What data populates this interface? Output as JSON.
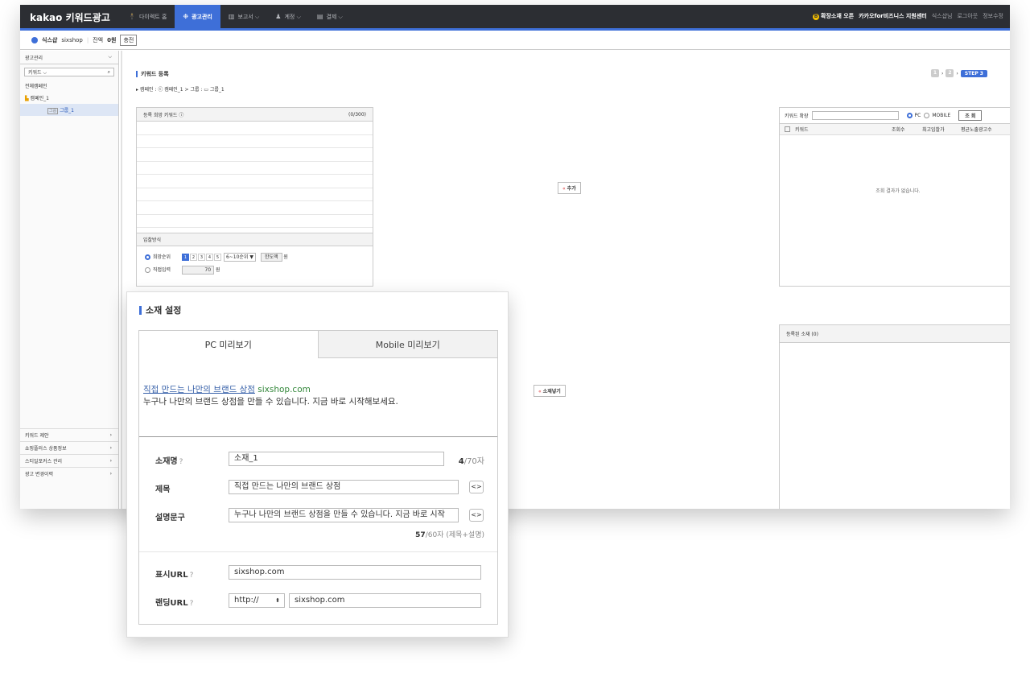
{
  "app": {
    "logo": "kakao 키워드광고"
  },
  "nav": [
    {
      "icon": "🕴",
      "label": "다이렉트 홈",
      "active": false
    },
    {
      "icon": "❉",
      "label": "광고관리",
      "active": true
    },
    {
      "icon": "▥",
      "label": "보고서 ⌵",
      "active": false
    },
    {
      "icon": "♟",
      "label": "계정 ⌵",
      "active": false
    },
    {
      "icon": "▤",
      "label": "결제 ⌵",
      "active": false
    }
  ],
  "top_right": {
    "badge": "B",
    "intro": "확장소재 오픈",
    "center": "카카오for비즈니스 지원센터",
    "user": "식스샵님",
    "logout": "로그아웃",
    "account": "정보수정"
  },
  "subbar": {
    "name": "식스샵",
    "id": "sixshop",
    "balance_label": "잔액",
    "balance": "0원",
    "charge": "충전"
  },
  "sidebar": {
    "header": "광고관리",
    "filter": "키워드 ⌵",
    "tree": [
      "전체캠페인",
      "캠페인_1",
      "그룹_1"
    ],
    "tree_tag": "그룹",
    "bottom": [
      "키워드 제안",
      "쇼핑플러스 상품정보",
      "스티일포커스 관리",
      "광고 변경이력"
    ]
  },
  "keyword": {
    "section": "키워드 등록",
    "breadcrumb": "캠페인 : ⓒ 캠페인_1 > 그룹 : ▭ 그룹_1",
    "steps": [
      "1",
      "2",
      "STEP 3"
    ],
    "panel_title": "등록 희망 키워드 ⓘ",
    "count": "(0/300)",
    "bid_title": "입찰방식",
    "bid_rank_label": "희망순위",
    "ranks": [
      "1",
      "2",
      "3",
      "4",
      "5"
    ],
    "rank_select": "6~10순위",
    "limit": "한도액",
    "won": "원",
    "bid_direct_label": "직접입력",
    "direct_value": "70",
    "add_button": "추가",
    "expand_label": "키워드 확장",
    "pc": "PC",
    "mobile": "MOBILE",
    "search_button": "조 회",
    "cols": [
      "키워드",
      "조회수",
      "최고입찰가",
      "평균노출광고수"
    ],
    "empty": "조회 결과가 없습니다."
  },
  "creative": {
    "registered": "등록된 소재 (0)",
    "insert_button": "소재넣기"
  },
  "popup": {
    "title": "소재 설정",
    "tab_pc": "PC 미리보기",
    "tab_mobile": "Mobile 미리보기",
    "preview_title": "직접 만드는 나만의 브랜드 상점",
    "preview_url": "sixshop.com",
    "preview_desc": "누구나 나만의 브랜드 상점을 만들 수 있습니다. 지금 바로 시작해보세요.",
    "name_label": "소재명",
    "name_value": "소재_1",
    "name_count": "4",
    "name_max": "/70자",
    "title_label": "제목",
    "title_value": "직접 만드는 나만의 브랜드 상점",
    "desc_label": "설명문구",
    "desc_value": "누구나 나만의 브랜드 상점을 만들 수 있습니다. 지금 바로 시작",
    "desc_count": "57",
    "desc_max": "/60자 (제목+설명)",
    "display_url_label": "표시URL",
    "display_url": "sixshop.com",
    "link_url_label": "랜딩URL",
    "protocol": "http://",
    "link_url": "sixshop.com",
    "help": "?",
    "toggle": "<>"
  }
}
